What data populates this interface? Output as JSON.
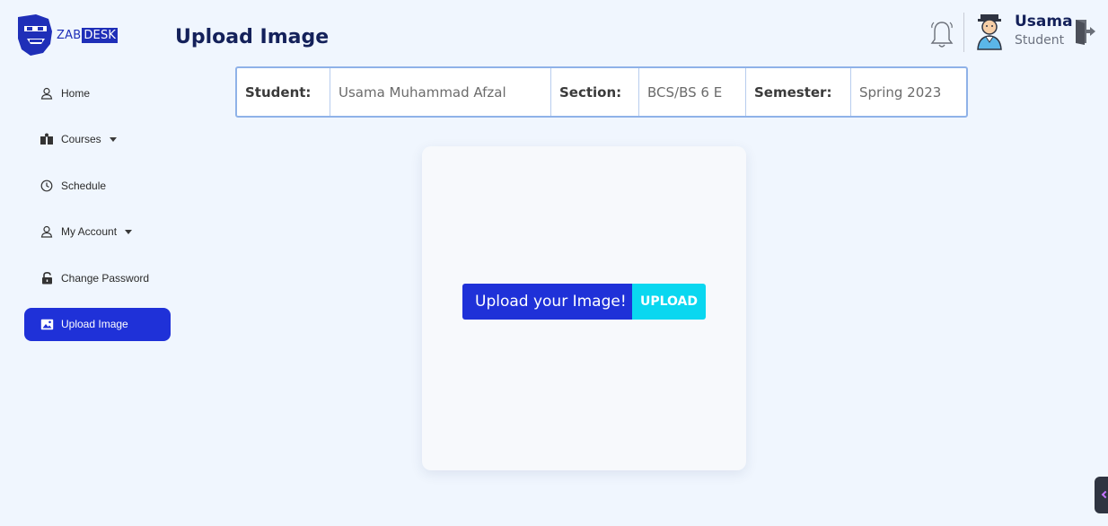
{
  "logo": {
    "zab": "ZAB",
    "desk": "DESK"
  },
  "header": {
    "title": "Upload Image"
  },
  "user": {
    "name": "Usama",
    "role": "Student"
  },
  "sidebar": {
    "items": [
      {
        "label": "Home",
        "icon": "user-icon"
      },
      {
        "label": "Courses",
        "icon": "books-icon",
        "dropdown": true
      },
      {
        "label": "Schedule",
        "icon": "clock-icon"
      },
      {
        "label": "My Account",
        "icon": "user-icon",
        "dropdown": true
      },
      {
        "label": "Change Password",
        "icon": "lock-icon"
      },
      {
        "label": "Upload Image",
        "icon": "image-icon",
        "active": true
      }
    ]
  },
  "info": {
    "student_label": "Student:",
    "student_value": "Usama Muhammad Afzal",
    "section_label": "Section:",
    "section_value": "BCS/BS 6 E",
    "semester_label": "Semester:",
    "semester_value": "Spring 2023"
  },
  "upload": {
    "label": "Upload your Image!",
    "button": "UPLOAD"
  },
  "colors": {
    "accent": "#1f31d8",
    "upload_button": "#0ad7f0",
    "title": "#14215a",
    "background": "#f0f6fe"
  }
}
